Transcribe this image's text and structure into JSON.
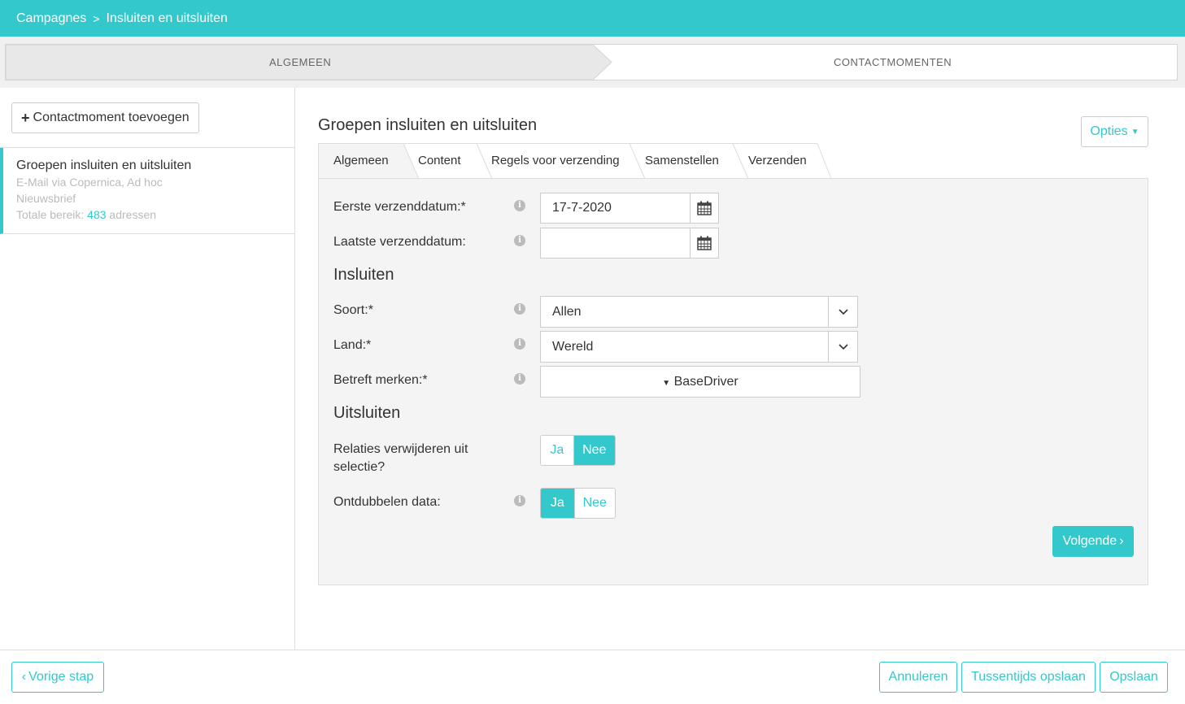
{
  "breadcrumb": {
    "items": [
      "Campagnes",
      "Insluiten en uitsluiten"
    ],
    "separator": ">"
  },
  "steps": [
    "ALGEMEEN",
    "CONTACTMOMENTEN"
  ],
  "sidebar": {
    "add_button": "Contactmoment toevoegen",
    "item": {
      "title": "Groepen insluiten en uitsluiten",
      "line1": "E-Mail via Copernica, Ad hoc",
      "line2": "Nieuwsbrief",
      "reach_prefix": "Totale bereik:",
      "reach_count": "483",
      "reach_suffix": "adressen"
    }
  },
  "main": {
    "title": "Groepen insluiten en uitsluiten",
    "options_label": "Opties",
    "tabs": [
      "Algemeen",
      "Content",
      "Regels voor verzending",
      "Samenstellen",
      "Verzenden"
    ],
    "active_tab": "Algemeen"
  },
  "form": {
    "first_date": {
      "label": "Eerste verzenddatum:*",
      "value": "17-7-2020"
    },
    "last_date": {
      "label": "Laatste verzenddatum:",
      "value": ""
    },
    "include_section": "Insluiten",
    "soort": {
      "label": "Soort:*",
      "value": "Allen"
    },
    "land": {
      "label": "Land:*",
      "value": "Wereld"
    },
    "merken": {
      "label": "Betreft merken:*",
      "value": "BaseDriver"
    },
    "exclude_section": "Uitsluiten",
    "relaties": {
      "label_line1": "Relaties verwijderen uit",
      "label_line2": "selectie?",
      "yes": "Ja",
      "no": "Nee",
      "selected": "Nee"
    },
    "ontdubbelen": {
      "label": "Ontdubbelen data:",
      "yes": "Ja",
      "no": "Nee",
      "selected": "Ja"
    },
    "next_button": "Volgende"
  },
  "footer": {
    "back": "Vorige stap",
    "cancel": "Annuleren",
    "save_draft": "Tussentijds opslaan",
    "save": "Opslaan"
  },
  "colors": {
    "accent": "#33c9cc"
  }
}
